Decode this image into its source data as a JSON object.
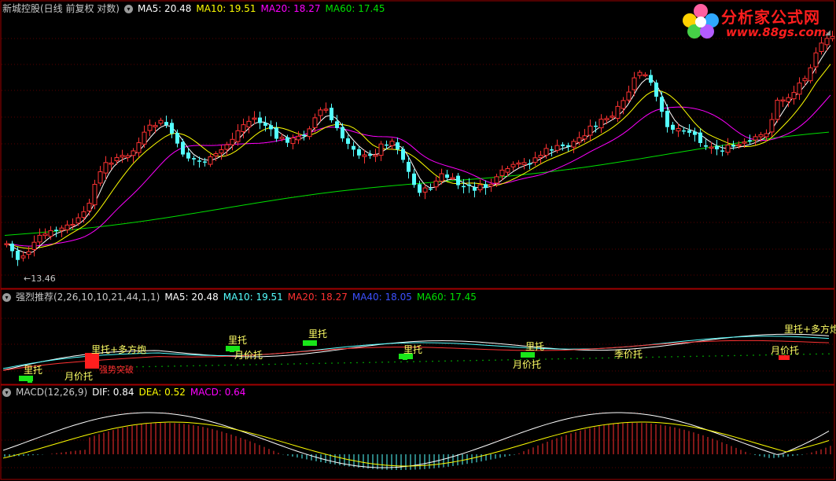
{
  "colors": {
    "up": "#ff3232",
    "down": "#54ffff",
    "ma5": "#ffffff",
    "ma10": "#ffff00",
    "ma20": "#ff00ff",
    "ma60": "#00e000",
    "grid": "#5a0000",
    "border": "#a00000",
    "ma40": "#3c50ff",
    "macd_red": "#ff3030",
    "macd_cyan": "#54ffff",
    "signal_green": "#19e619",
    "signal_red": "#ff1e1e"
  },
  "main": {
    "title": "新城控股(日线 前复权 对数)",
    "ma5": "MA5: 20.48",
    "ma10": "MA10: 19.51",
    "ma20": "MA20: 18.27",
    "ma60": "MA60: 17.45",
    "low_label": "13.46",
    "settings_icon": "circle-down-icon"
  },
  "indicator": {
    "title": "强烈推荐(2,26,10,10,21,44,1,1)",
    "ma5": "MA5: 20.48",
    "ma10": "MA10: 19.51",
    "ma20": "MA20: 18.27",
    "ma40": "MA40: 18.05",
    "ma60": "MA60: 17.45",
    "labels": {
      "l1": "里托",
      "l2": "月价托",
      "l3": "里托+多方炮",
      "l4": "强势突破",
      "l5": "里托",
      "l6": "月价托",
      "l7": "里托",
      "l8": "里托",
      "l9": "月价托",
      "l10": "季价托",
      "l11": "里托+多方炮",
      "l12": "月价托"
    }
  },
  "macd": {
    "title": "MACD(12,26,9)",
    "dif": "DIF: 0.84",
    "dea": "DEA: 0.52",
    "macd": "MACD: 0.64"
  },
  "logo": {
    "name": "分析家公式网",
    "url": "www.88gs.com"
  },
  "chart_data": [
    {
      "type": "candlestick",
      "name": "新城控股 日线",
      "low_marker": 13.46,
      "ma5": 20.48,
      "ma10": 19.51,
      "ma20": 18.27,
      "ma60": 17.45
    },
    {
      "type": "line",
      "name": "强烈推荐",
      "ma5": 20.48,
      "ma10": 19.51,
      "ma20": 18.27,
      "ma40": 18.05,
      "ma60": 17.45
    },
    {
      "type": "bar",
      "name": "MACD",
      "dif": 0.84,
      "dea": 0.52,
      "macd": 0.64
    }
  ]
}
